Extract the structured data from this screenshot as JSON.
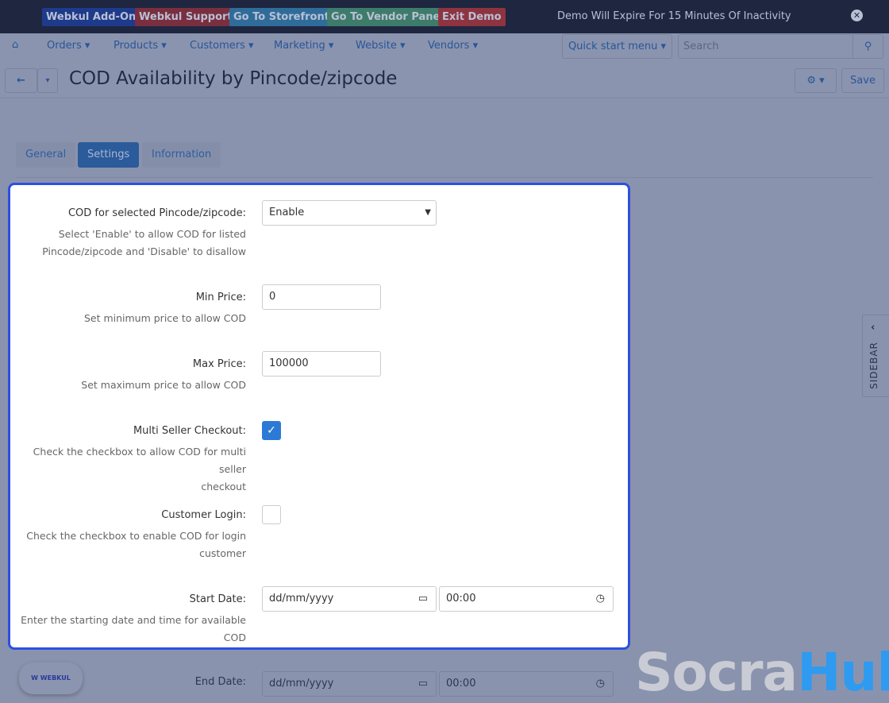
{
  "topbar": {
    "buttons": [
      {
        "label": "Webkul Add-On",
        "color": "#1e3a8a"
      },
      {
        "label": "Webkul Support",
        "color": "#7a2f3f"
      },
      {
        "label": "Go To Storefront",
        "color": "#2f6c9a"
      },
      {
        "label": "Go To Vendor Panel",
        "color": "#3d7c6a"
      },
      {
        "label": "Exit Demo",
        "color": "#8e3440"
      }
    ],
    "notice": "Demo Will Expire For 15 Minutes Of Inactivity"
  },
  "nav": {
    "items": [
      "Orders",
      "Products",
      "Customers",
      "Marketing",
      "Website",
      "Vendors"
    ],
    "quick_start": "Quick start menu",
    "search_placeholder": "Search"
  },
  "header": {
    "title": "COD Availability by Pincode/zipcode",
    "save": "Save"
  },
  "tabs": [
    "General",
    "Settings",
    "Information"
  ],
  "form": {
    "cod": {
      "label": "COD for selected Pincode/zipcode:",
      "value": "Enable",
      "hint1": "Select 'Enable' to allow COD for listed",
      "hint2": "Pincode/zipcode and 'Disable' to disallow"
    },
    "min": {
      "label": "Min Price:",
      "value": "0",
      "hint": "Set minimum price to allow COD"
    },
    "max": {
      "label": "Max Price:",
      "value": "100000",
      "hint": "Set maximum price to allow COD"
    },
    "multi": {
      "label": "Multi Seller Checkout:",
      "checked": true,
      "hint1": "Check the checkbox to allow COD for multi seller",
      "hint2": "checkout"
    },
    "login": {
      "label": "Customer Login:",
      "checked": false,
      "hint1": "Check the checkbox to enable COD for login",
      "hint2": "customer"
    },
    "start": {
      "label": "Start Date:",
      "date": "dd/mm/yyyy",
      "time": "00:00",
      "hint1": "Enter the starting date and time for available",
      "hint2": "COD"
    },
    "end": {
      "label": "End Date:",
      "date": "dd/mm/yyyy",
      "time": "00:00"
    }
  },
  "sidebar_label": "SIDEBAR",
  "watermark": {
    "part1": "Socra",
    "part2": "Hub"
  },
  "logo": "WEBKUL"
}
